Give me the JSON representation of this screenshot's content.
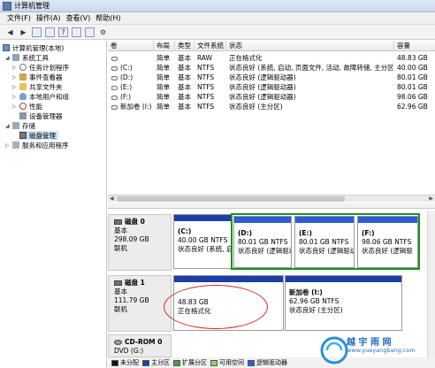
{
  "window": {
    "title": "计算机管理"
  },
  "menu": [
    "文件(F)",
    "操作(A)",
    "查看(V)",
    "帮助(H)"
  ],
  "tree": {
    "root": "计算机管理(本地)",
    "system_tools": "系统工具",
    "task_scheduler": "任务计划程序",
    "event_viewer": "事件查看器",
    "shared_folders": "共享文件夹",
    "local_users": "本地用户和组",
    "performance": "性能",
    "device_manager": "设备管理器",
    "storage": "存储",
    "disk_management": "磁盘管理",
    "services_apps": "服务和应用程序"
  },
  "table": {
    "headers": [
      "卷",
      "布局",
      "类型",
      "文件系统",
      "状态",
      "容量"
    ],
    "rows": [
      {
        "vol": "",
        "layout": "简单",
        "type": "基本",
        "fs": "RAW",
        "status": "正在格式化",
        "cap": "48.83 GB"
      },
      {
        "vol": "(C:)",
        "layout": "简单",
        "type": "基本",
        "fs": "NTFS",
        "status": "状态良好 (系统, 启动, 页面文件, 活动, 故障转储, 主分区)",
        "cap": "40.00 GB"
      },
      {
        "vol": "(D:)",
        "layout": "简单",
        "type": "基本",
        "fs": "NTFS",
        "status": "状态良好 (逻辑驱动器)",
        "cap": "80.01 GB"
      },
      {
        "vol": "(E:)",
        "layout": "简单",
        "type": "基本",
        "fs": "NTFS",
        "status": "状态良好 (逻辑驱动器)",
        "cap": "80.01 GB"
      },
      {
        "vol": "(F:)",
        "layout": "简单",
        "type": "基本",
        "fs": "NTFS",
        "status": "状态良好 (逻辑驱动器)",
        "cap": "98.06 GB"
      },
      {
        "vol": "新加卷 (I:)",
        "layout": "简单",
        "type": "基本",
        "fs": "NTFS",
        "status": "状态良好 (主分区)",
        "cap": "62.96 GB"
      }
    ]
  },
  "disk0": {
    "name": "磁盘 0",
    "type": "基本",
    "size": "298.09 GB",
    "state": "联机",
    "parts": [
      {
        "name": "(C:)",
        "size": "40.00 GB NTFS",
        "status": "状态良好 (系统, 启"
      },
      {
        "name": "(D:)",
        "size": "80.01 GB NTFS",
        "status": "状态良好 (逻辑驱动"
      },
      {
        "name": "(E:)",
        "size": "80.01 GB NTFS",
        "status": "状态良好 (逻辑驱动"
      },
      {
        "name": "(F:)",
        "size": "98.06 GB NTFS",
        "status": "状态良好 (逻辑驱"
      }
    ]
  },
  "disk1": {
    "name": "磁盘 1",
    "type": "基本",
    "size": "111.79 GB",
    "state": "联机",
    "parts": [
      {
        "name": "",
        "size": "48.83 GB",
        "status": "正在格式化"
      },
      {
        "name": "新加卷  (I:)",
        "size": "62.96 GB NTFS",
        "status": "状态良好 (主分区)"
      }
    ]
  },
  "cdrom": {
    "name": "CD-ROM 0",
    "drive": "DVD (G:)"
  },
  "legend": [
    "未分配",
    "主分区",
    "扩展分区",
    "可用空间",
    "逻辑驱动器"
  ],
  "watermark": {
    "text": "越  宇  雨  网",
    "url": "www.yueyangbang.com"
  },
  "colors": {
    "primary": "#1c3fa8",
    "logical": "#2e5bd6",
    "unallocated": "#111111",
    "extended": "#3da53d",
    "free": "#8dcf6b",
    "selection_green": "#1e8f1e",
    "annotation_red": "#d92a2a"
  }
}
